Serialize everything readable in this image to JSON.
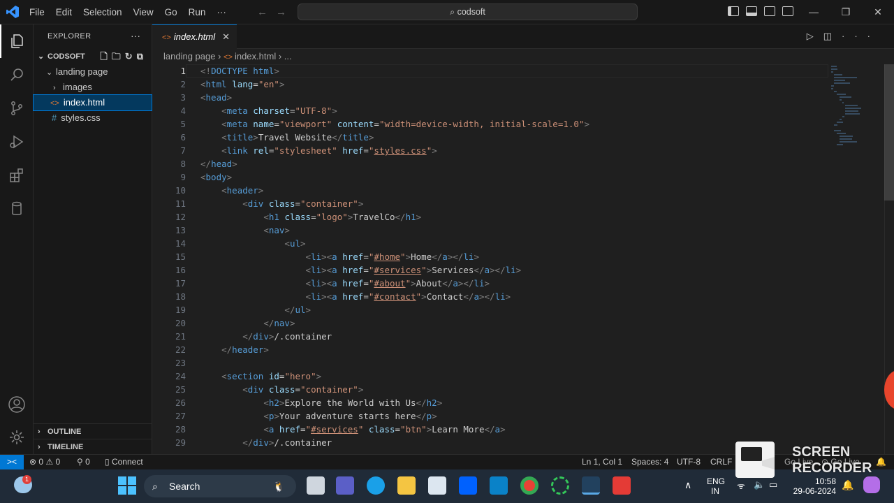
{
  "titlebar": {
    "menu": [
      "File",
      "Edit",
      "Selection",
      "View",
      "Go",
      "Run",
      "···"
    ],
    "command_center": "codsoft"
  },
  "sidebar": {
    "title": "EXPLORER",
    "more": "···",
    "root_folder": "CODSOFT",
    "items": [
      {
        "label": "landing page",
        "type": "folder-open",
        "indent": 1
      },
      {
        "label": "images",
        "type": "folder-closed",
        "indent": 2
      },
      {
        "label": "index.html",
        "type": "html-file",
        "indent": 2,
        "selected": true
      },
      {
        "label": "styles.css",
        "type": "css-file",
        "indent": 2
      }
    ],
    "outline_label": "OUTLINE",
    "timeline_label": "TIMELINE"
  },
  "tabs": [
    {
      "label": "index.html",
      "active": true,
      "icon": "html-icon"
    }
  ],
  "breadcrumb": [
    "landing page",
    "index.html",
    "..."
  ],
  "editor": {
    "current_line": 1,
    "lines": [
      "<!DOCTYPE html>",
      "<html lang=\"en\">",
      "<head>",
      "    <meta charset=\"UTF-8\">",
      "    <meta name=\"viewport\" content=\"width=device-width, initial-scale=1.0\">",
      "    <title>Travel Website</title>",
      "    <link rel=\"stylesheet\" href=\"styles.css\">",
      "</head>",
      "<body>",
      "    <header>",
      "        <div class=\"container\">",
      "            <h1 class=\"logo\">TravelCo</h1>",
      "            <nav>",
      "                <ul>",
      "                    <li><a href=\"#home\">Home</a></li>",
      "                    <li><a href=\"#services\">Services</a></li>",
      "                    <li><a href=\"#about\">About</a></li>",
      "                    <li><a href=\"#contact\">Contact</a></li>",
      "                </ul>",
      "            </nav>",
      "        </div>/.container",
      "    </header>",
      "",
      "    <section id=\"hero\">",
      "        <div class=\"container\">",
      "            <h2>Explore the World with Us</h2>",
      "            <p>Your adventure starts here</p>",
      "            <a href=\"#services\" class=\"btn\">Learn More</a>",
      "        </div>/.container"
    ]
  },
  "statusbar": {
    "remote": "><",
    "errors": "0",
    "warnings": "0",
    "ports": "0",
    "connect": "Connect",
    "position": "Ln 1, Col 1",
    "spaces": "Spaces: 4",
    "encoding": "UTF-8",
    "eol": "CRLF",
    "golive_1": "Go Live",
    "golive_2": "Go Live"
  },
  "taskbar": {
    "search_placeholder": "Search",
    "weather_badge": "1",
    "lang_1": "ENG",
    "lang_2": "IN",
    "time": "10:58",
    "date": "29-06-2024"
  },
  "overlay": {
    "line1": "SCREEN",
    "line2": "RECORDER"
  },
  "colors": {
    "accent": "#0078d4",
    "tag": "#569cd6",
    "attr": "#9cdcfe",
    "string": "#ce9178",
    "punct": "#808080"
  }
}
